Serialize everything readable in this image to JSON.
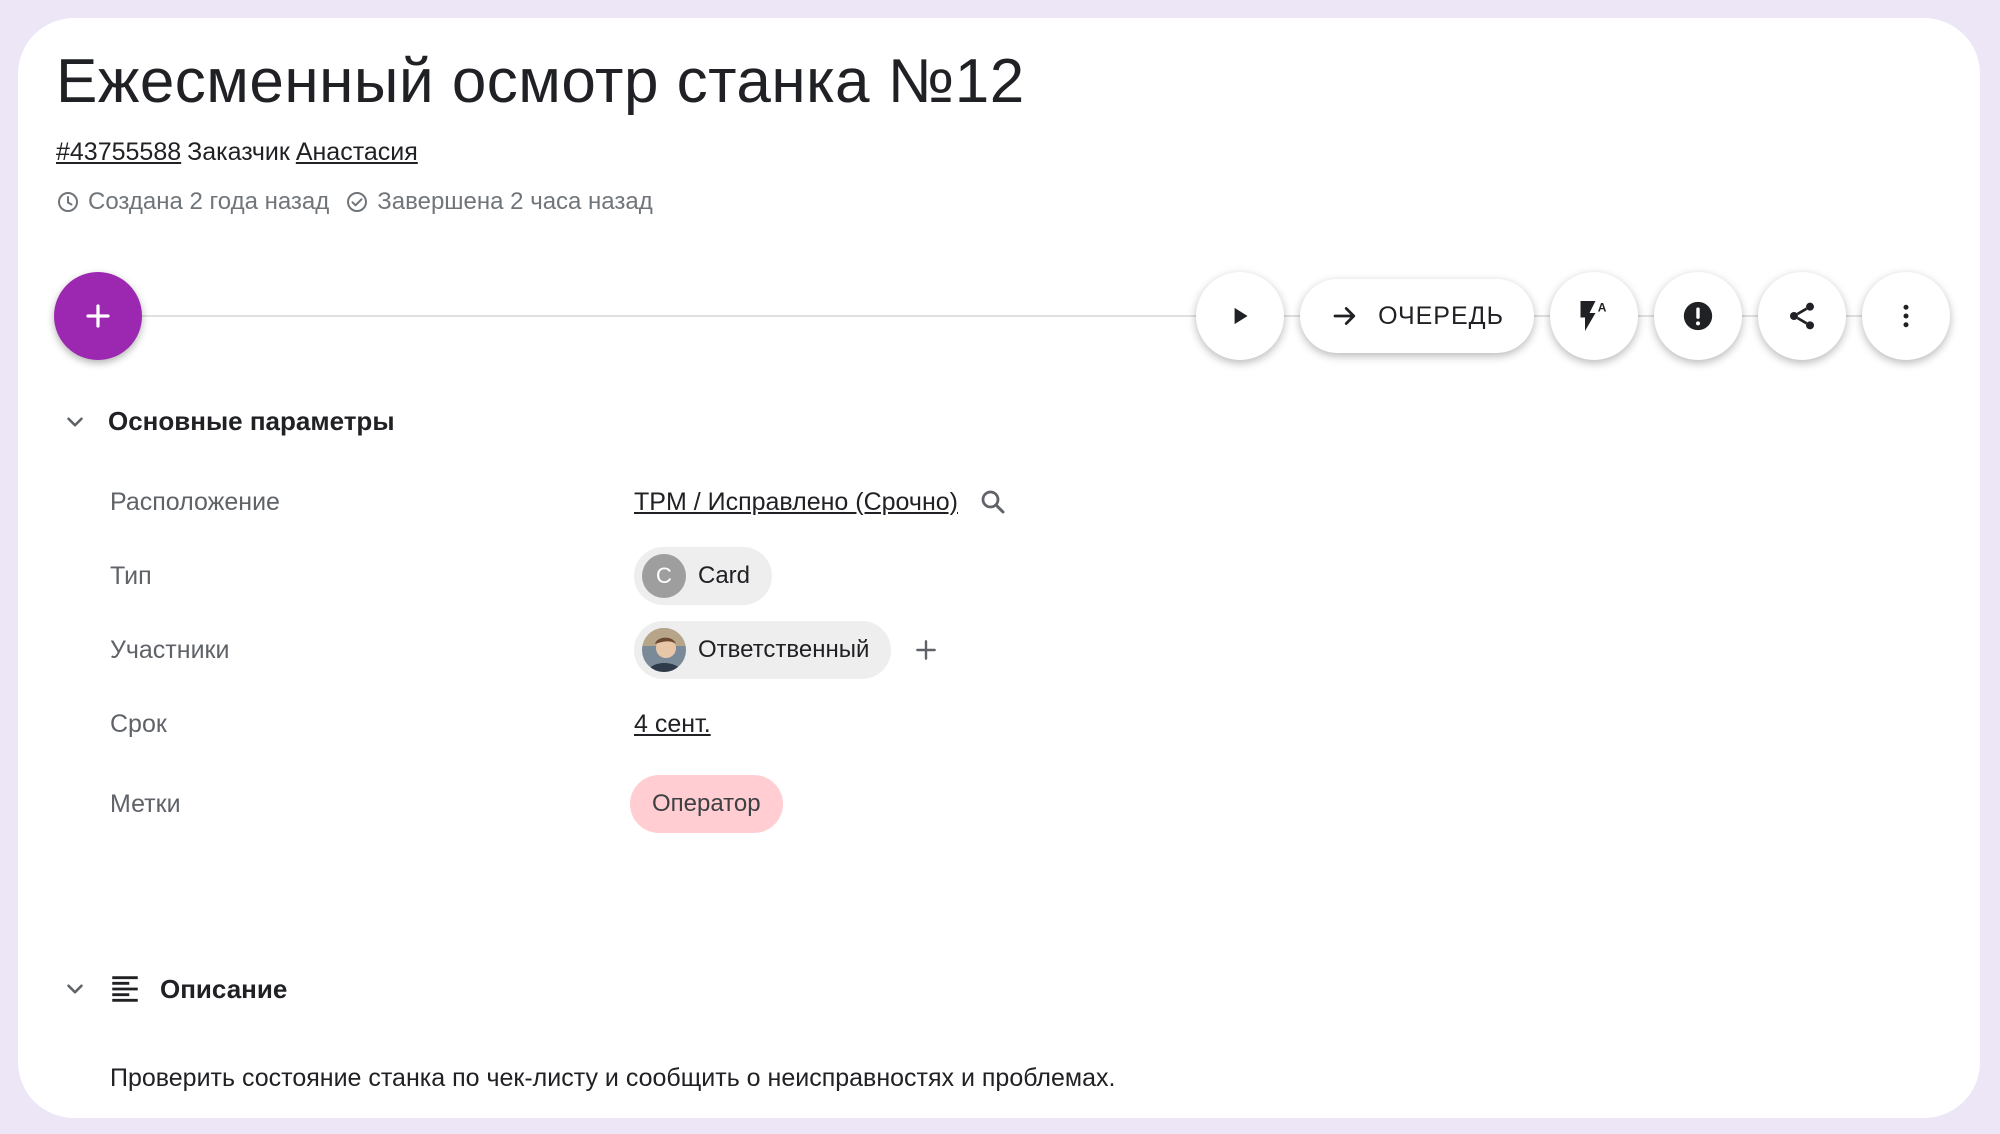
{
  "header": {
    "title": "Ежесменный осмотр станка №12",
    "ticket_id": "#43755588",
    "customer_label": "Заказчик",
    "customer_name": "Анастасия",
    "created": "Создана 2 года назад",
    "completed": "Завершена 2 часа назад"
  },
  "toolbar": {
    "add_icon": "plus-icon",
    "queue_label": "ОЧЕРЕДЬ",
    "buttons": [
      "play-icon",
      "arrow-right-icon",
      "flash-auto-icon",
      "priority-icon",
      "share-icon",
      "more-vert-icon"
    ]
  },
  "main_params": {
    "section_title": "Основные параметры",
    "location_label": "Расположение",
    "location_value": "TPM / Исправлено (Срочно)",
    "type_label": "Тип",
    "type_avatar_letter": "C",
    "type_value": "Card",
    "participants_label": "Участники",
    "participant_role": "Ответственный",
    "due_label": "Срок",
    "due_value": "4 сент.",
    "tags_label": "Метки",
    "tag_value": "Оператор",
    "tag_color": "#ffcdd2"
  },
  "description": {
    "section_title": "Описание",
    "text": "Проверить состояние станка по чек-листу и сообщить о неисправностях и проблемах."
  },
  "colors": {
    "fab": "#9c27b0",
    "background": "#ece6f7"
  }
}
